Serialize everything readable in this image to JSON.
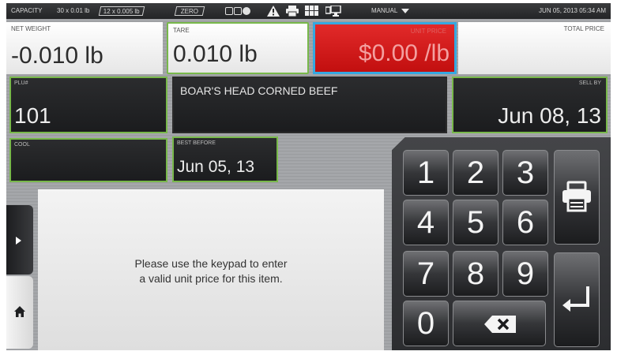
{
  "status_bar": {
    "capacity_label": "CAPACITY",
    "capacity_1": "30 x 0.01 lb",
    "capacity_2": "12 x 0.005 lb",
    "zero": "ZERO",
    "mode": "MANUAL",
    "datetime": "JUN 05, 2013 05:34 AM",
    "icons": [
      "warning-icon",
      "printer-icon",
      "grid-icon",
      "network-icon"
    ]
  },
  "scale": {
    "net_weight": {
      "label": "NET WEIGHT",
      "value": "-0.010 lb"
    },
    "tare": {
      "label": "TARE",
      "value": "0.010 lb"
    },
    "unit_price": {
      "label": "UNIT PRICE",
      "value": "$0.00 /lb"
    },
    "total_price": {
      "label": "TOTAL PRICE",
      "value": ""
    }
  },
  "item": {
    "plu_label": "PLU#",
    "plu": "101",
    "description": "BOAR'S HEAD CORNED BEEF",
    "sell_by_label": "SELL BY",
    "sell_by": "Jun 08, 13",
    "cool_label": "COOL",
    "cool": "",
    "best_before_label": "BEST BEFORE",
    "best_before": "Jun 05, 13"
  },
  "message": {
    "line1": "Please use the keypad to enter",
    "line2": "a valid unit price for this item."
  },
  "keypad": {
    "keys": [
      "1",
      "2",
      "3",
      "4",
      "5",
      "6",
      "7",
      "8",
      "9",
      "0"
    ]
  },
  "colors": {
    "accent_green": "#78b84a",
    "alert_red": "#d01a1a",
    "highlight_blue": "#36a8e0"
  }
}
